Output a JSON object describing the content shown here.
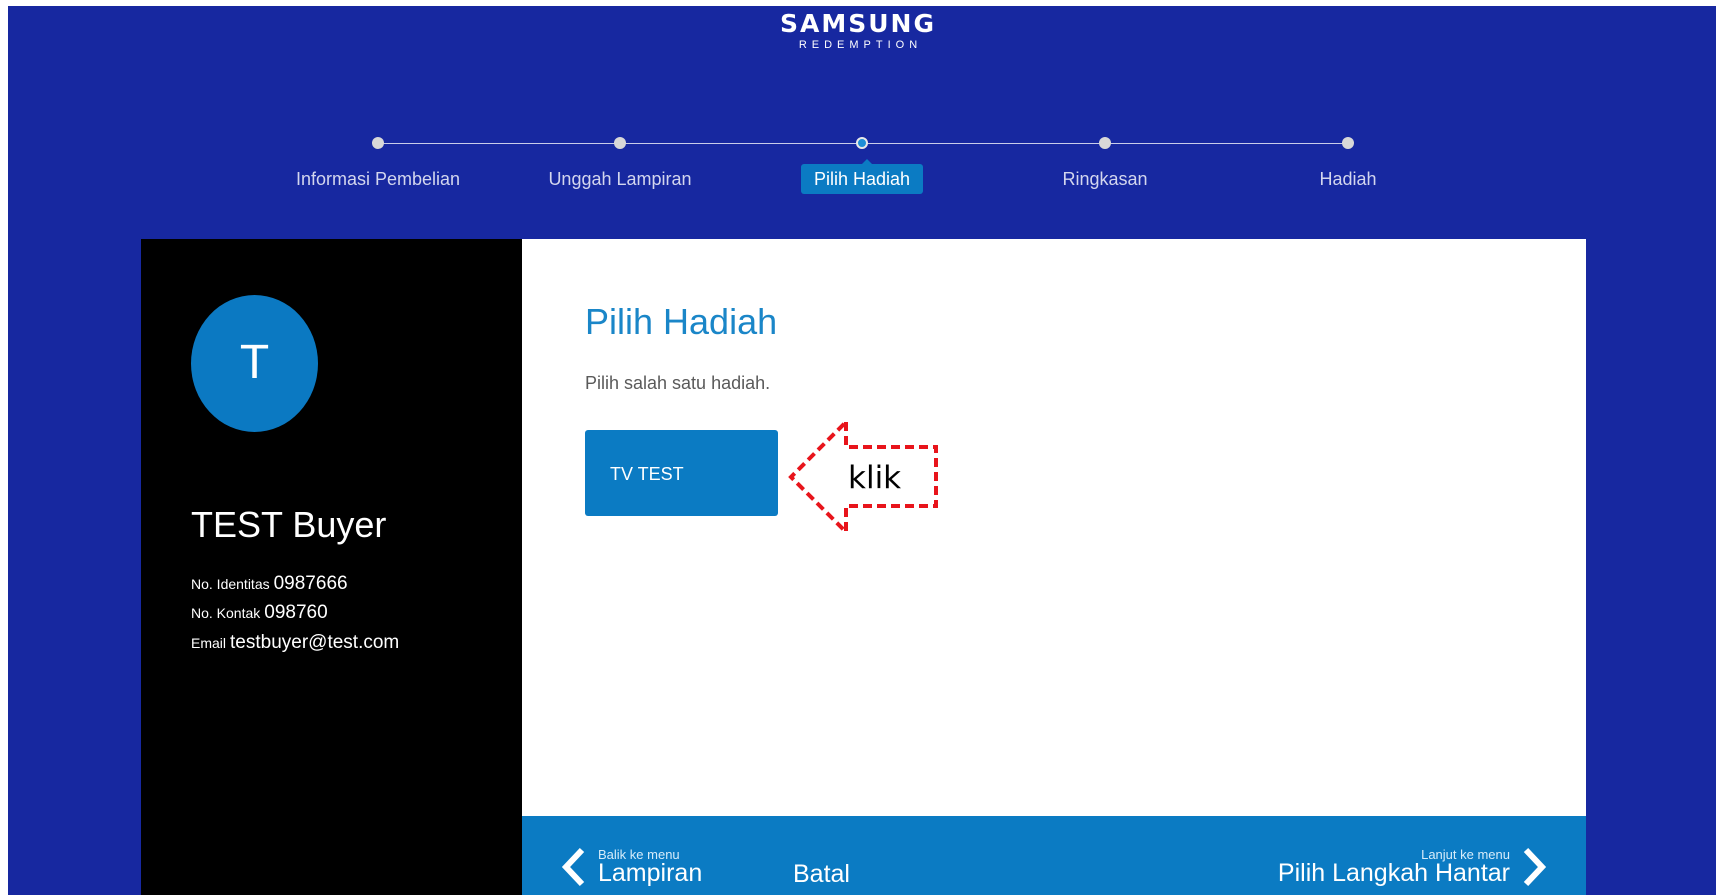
{
  "header": {
    "brand": "SAMSUNG",
    "subtitle": "REDEMPTION"
  },
  "steps": [
    {
      "label": "Informasi Pembelian",
      "active": false
    },
    {
      "label": "Unggah Lampiran",
      "active": false
    },
    {
      "label": "Pilih Hadiah",
      "active": true
    },
    {
      "label": "Ringkasan",
      "active": false
    },
    {
      "label": "Hadiah",
      "active": false
    }
  ],
  "user": {
    "initial": "T",
    "name": "TEST Buyer",
    "id_label": "No. Identitas",
    "id_value": "0987666",
    "contact_label": "No. Kontak",
    "contact_value": "098760",
    "email_label": "Email",
    "email_value": "testbuyer@test.com"
  },
  "main": {
    "title": "Pilih Hadiah",
    "subtitle": "Pilih salah satu hadiah.",
    "gifts": [
      "TV TEST"
    ]
  },
  "annotation": {
    "text": "klik",
    "color": "#e8141b"
  },
  "footer": {
    "back_small": "Balik ke menu",
    "back_label": "Lampiran",
    "cancel_label": "Batal",
    "next_small": "Lanjut ke menu",
    "next_label": "Pilih Langkah Hantar"
  },
  "colors": {
    "background": "#1728a0",
    "accent": "#0b7bc3",
    "title": "#1a86c8"
  }
}
